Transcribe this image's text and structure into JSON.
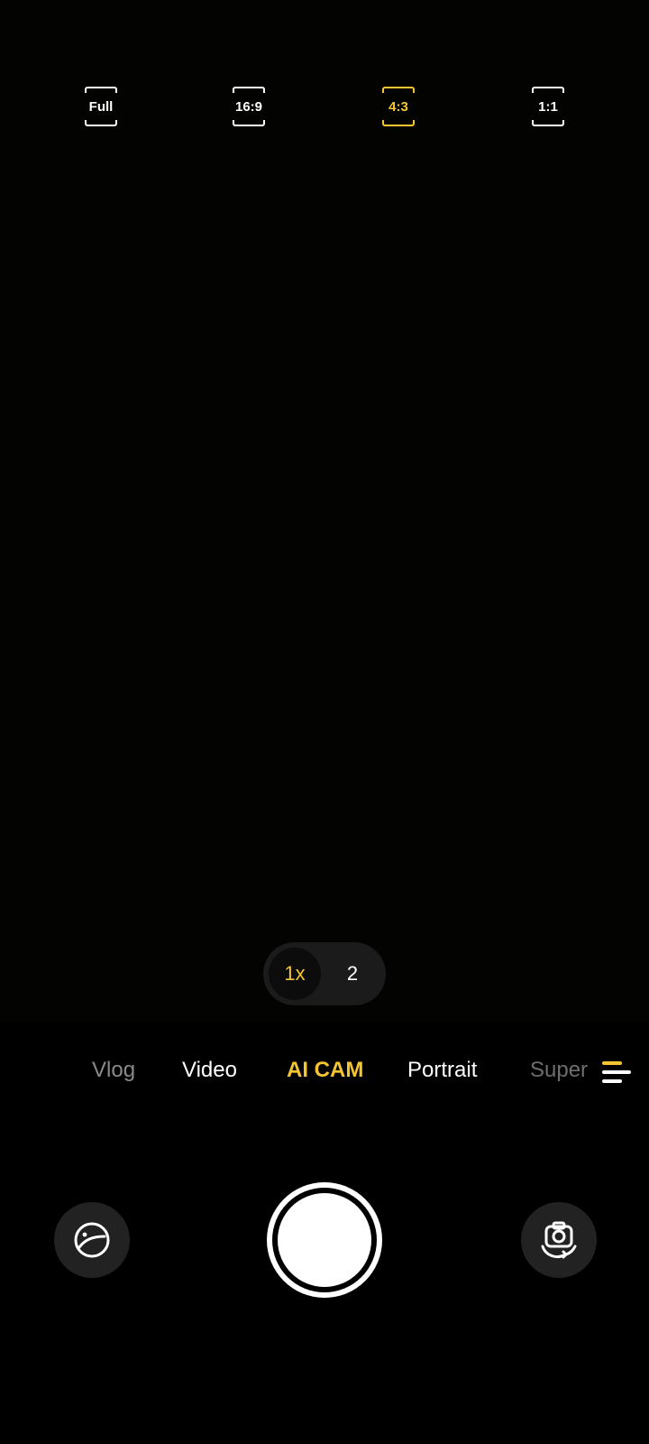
{
  "aspect_ratios": [
    {
      "label": "Full",
      "selected": false
    },
    {
      "label": "16:9",
      "selected": false
    },
    {
      "label": "4:3",
      "selected": true
    },
    {
      "label": "1:1",
      "selected": false
    }
  ],
  "zoom": {
    "options": [
      "1x",
      "2"
    ],
    "selected": "1x"
  },
  "modes": [
    "Vlog",
    "Video",
    "AI CAM",
    "Portrait",
    "Super"
  ],
  "active_mode": "AI CAM",
  "icons": {
    "gallery": "gallery-icon",
    "shutter": "shutter-icon",
    "flip": "switch-camera-icon",
    "more": "more-modes-icon"
  },
  "colors": {
    "accent": "#f5c531",
    "background": "#000000",
    "control_bg": "#222222"
  }
}
